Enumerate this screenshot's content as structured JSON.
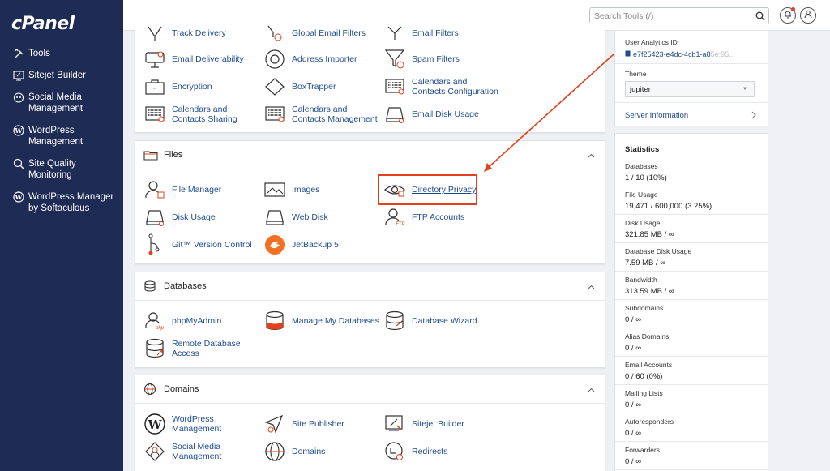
{
  "brand": {
    "logo": "cPanel"
  },
  "sidebar": {
    "items": [
      {
        "label": "Tools",
        "icon": "tools-icon"
      },
      {
        "label": "Sitejet Builder",
        "icon": "sitejet-icon"
      },
      {
        "label": "Social Media Management",
        "icon": "social-media-icon"
      },
      {
        "label": "WordPress Management",
        "icon": "wordpress-icon"
      },
      {
        "label": "Site Quality Monitoring",
        "icon": "site-quality-icon"
      },
      {
        "label": "WordPress Manager by Softaculous",
        "icon": "wordpress-icon"
      }
    ]
  },
  "topbar": {
    "search_placeholder": "Search Tools (/)"
  },
  "email_section": {
    "items": [
      {
        "label": "Track Delivery",
        "icon": "track-delivery-icon"
      },
      {
        "label": "Global Email Filters",
        "icon": "global-filter-icon"
      },
      {
        "label": "Email Filters",
        "icon": "filter-icon"
      },
      {
        "label": "Email Deliverability",
        "icon": "email-deliverability-icon"
      },
      {
        "label": "Address Importer",
        "icon": "address-importer-icon"
      },
      {
        "label": "Spam Filters",
        "icon": "spam-filter-icon"
      },
      {
        "label": "Encryption",
        "icon": "encryption-icon"
      },
      {
        "label": "BoxTrapper",
        "icon": "boxtrapper-icon"
      },
      {
        "label": "Calendars and Contacts Configuration",
        "icon": "calendar-icon"
      },
      {
        "label": "Calendars and Contacts Sharing",
        "icon": "calendar-icon"
      },
      {
        "label": "Calendars and Contacts Management",
        "icon": "calendar-icon"
      },
      {
        "label": "Email Disk Usage",
        "icon": "disk-usage-icon"
      }
    ]
  },
  "files_section": {
    "title": "Files",
    "items": [
      {
        "label": "File Manager",
        "icon": "file-manager-icon"
      },
      {
        "label": "Images",
        "icon": "images-icon"
      },
      {
        "label": "Directory Privacy",
        "icon": "directory-privacy-icon"
      },
      {
        "label": "Disk Usage",
        "icon": "disk-usage-icon"
      },
      {
        "label": "Web Disk",
        "icon": "web-disk-icon"
      },
      {
        "label": "FTP Accounts",
        "icon": "ftp-accounts-icon"
      },
      {
        "label": "Git™ Version Control",
        "icon": "git-icon"
      },
      {
        "label": "JetBackup 5",
        "icon": "jetbackup-icon"
      }
    ]
  },
  "databases_section": {
    "title": "Databases",
    "items": [
      {
        "label": "phpMyAdmin",
        "icon": "phpmyadmin-icon"
      },
      {
        "label": "Manage My Databases",
        "icon": "database-icon"
      },
      {
        "label": "Database Wizard",
        "icon": "database-wizard-icon"
      },
      {
        "label": "Remote Database Access",
        "icon": "remote-database-icon"
      }
    ]
  },
  "domains_section": {
    "title": "Domains",
    "items": [
      {
        "label": "WordPress Management",
        "icon": "wordpress-icon"
      },
      {
        "label": "Site Publisher",
        "icon": "site-publisher-icon"
      },
      {
        "label": "Sitejet Builder",
        "icon": "sitejet-icon"
      },
      {
        "label": "Social Media Management",
        "icon": "social-media-icon"
      },
      {
        "label": "Domains",
        "icon": "globe-icon"
      },
      {
        "label": "Redirects",
        "icon": "redirects-icon"
      }
    ]
  },
  "info": {
    "analytics_label": "User Analytics ID",
    "analytics_value": "e7f25423-e4dc-4cb1-a8",
    "analytics_faded": "5e:95...",
    "theme_label": "Theme",
    "theme_value": "jupiter",
    "server_info": "Server Information"
  },
  "statistics": {
    "title": "Statistics",
    "items": [
      {
        "label": "Databases",
        "value": "1 / 10   (10%)"
      },
      {
        "label": "File Usage",
        "value": "19,471 / 600,000   (3.25%)"
      },
      {
        "label": "Disk Usage",
        "value": "321.85 MB / ∞"
      },
      {
        "label": "Database Disk Usage",
        "value": "7.59 MB / ∞"
      },
      {
        "label": "Bandwidth",
        "value": "313.59 MB / ∞"
      },
      {
        "label": "Subdomains",
        "value": "0 / ∞"
      },
      {
        "label": "Alias Domains",
        "value": "0 / ∞"
      },
      {
        "label": "Email Accounts",
        "value": "0 / 60   (0%)"
      },
      {
        "label": "Mailing Lists",
        "value": "0 / ∞"
      },
      {
        "label": "Autoresponders",
        "value": "0 / ∞"
      },
      {
        "label": "Forwarders",
        "value": "0 / ∞"
      }
    ]
  },
  "colors": {
    "sidebar": "#1e2b55",
    "link": "#1f4b8e",
    "highlight": "#e3401d",
    "jetbackup": "#f36f21"
  }
}
